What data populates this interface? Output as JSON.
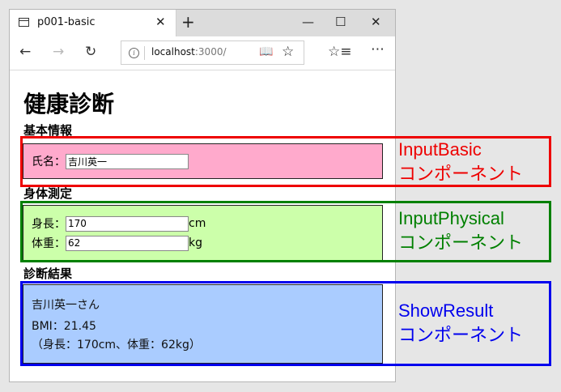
{
  "browser": {
    "tab_title": "p001-basic",
    "url_host": "localhost",
    "url_rest": ":3000/"
  },
  "page": {
    "title": "健康診断",
    "basic": {
      "heading": "基本情報",
      "name_label": "氏名：",
      "name_value": "吉川英一"
    },
    "physical": {
      "heading": "身体測定",
      "height_label": "身長：",
      "height_value": "170",
      "height_unit": "cm",
      "weight_label": "体重：",
      "weight_value": "62",
      "weight_unit": "kg"
    },
    "result": {
      "heading": "診断結果",
      "line1": "吉川英一さん",
      "line2": "BMI：21.45",
      "line3": "（身長：170cm、体重：62kg）"
    }
  },
  "annotations": [
    {
      "name": "InputBasic",
      "sub": "コンポーネント",
      "color": "#ee0000"
    },
    {
      "name": "InputPhysical",
      "sub": "コンポーネント",
      "color": "#008000"
    },
    {
      "name": "ShowResult",
      "sub": "コンポーネント",
      "color": "#0000ee"
    }
  ],
  "colors": {
    "basic_bg": "#ffaacc",
    "physical_bg": "#ccffaa",
    "result_bg": "#aaccff"
  },
  "icons": {
    "tab": "page-icon",
    "close": "close-icon",
    "new_tab": "plus-icon",
    "minimize": "minimize-icon",
    "maximize": "maximize-icon",
    "window_close": "close-icon",
    "back": "back-arrow-icon",
    "forward": "forward-arrow-icon",
    "refresh": "refresh-icon",
    "info": "info-icon",
    "reading_view": "book-icon",
    "favorite": "star-icon",
    "favorites_hub": "favorites-list-icon",
    "more": "more-icon"
  }
}
